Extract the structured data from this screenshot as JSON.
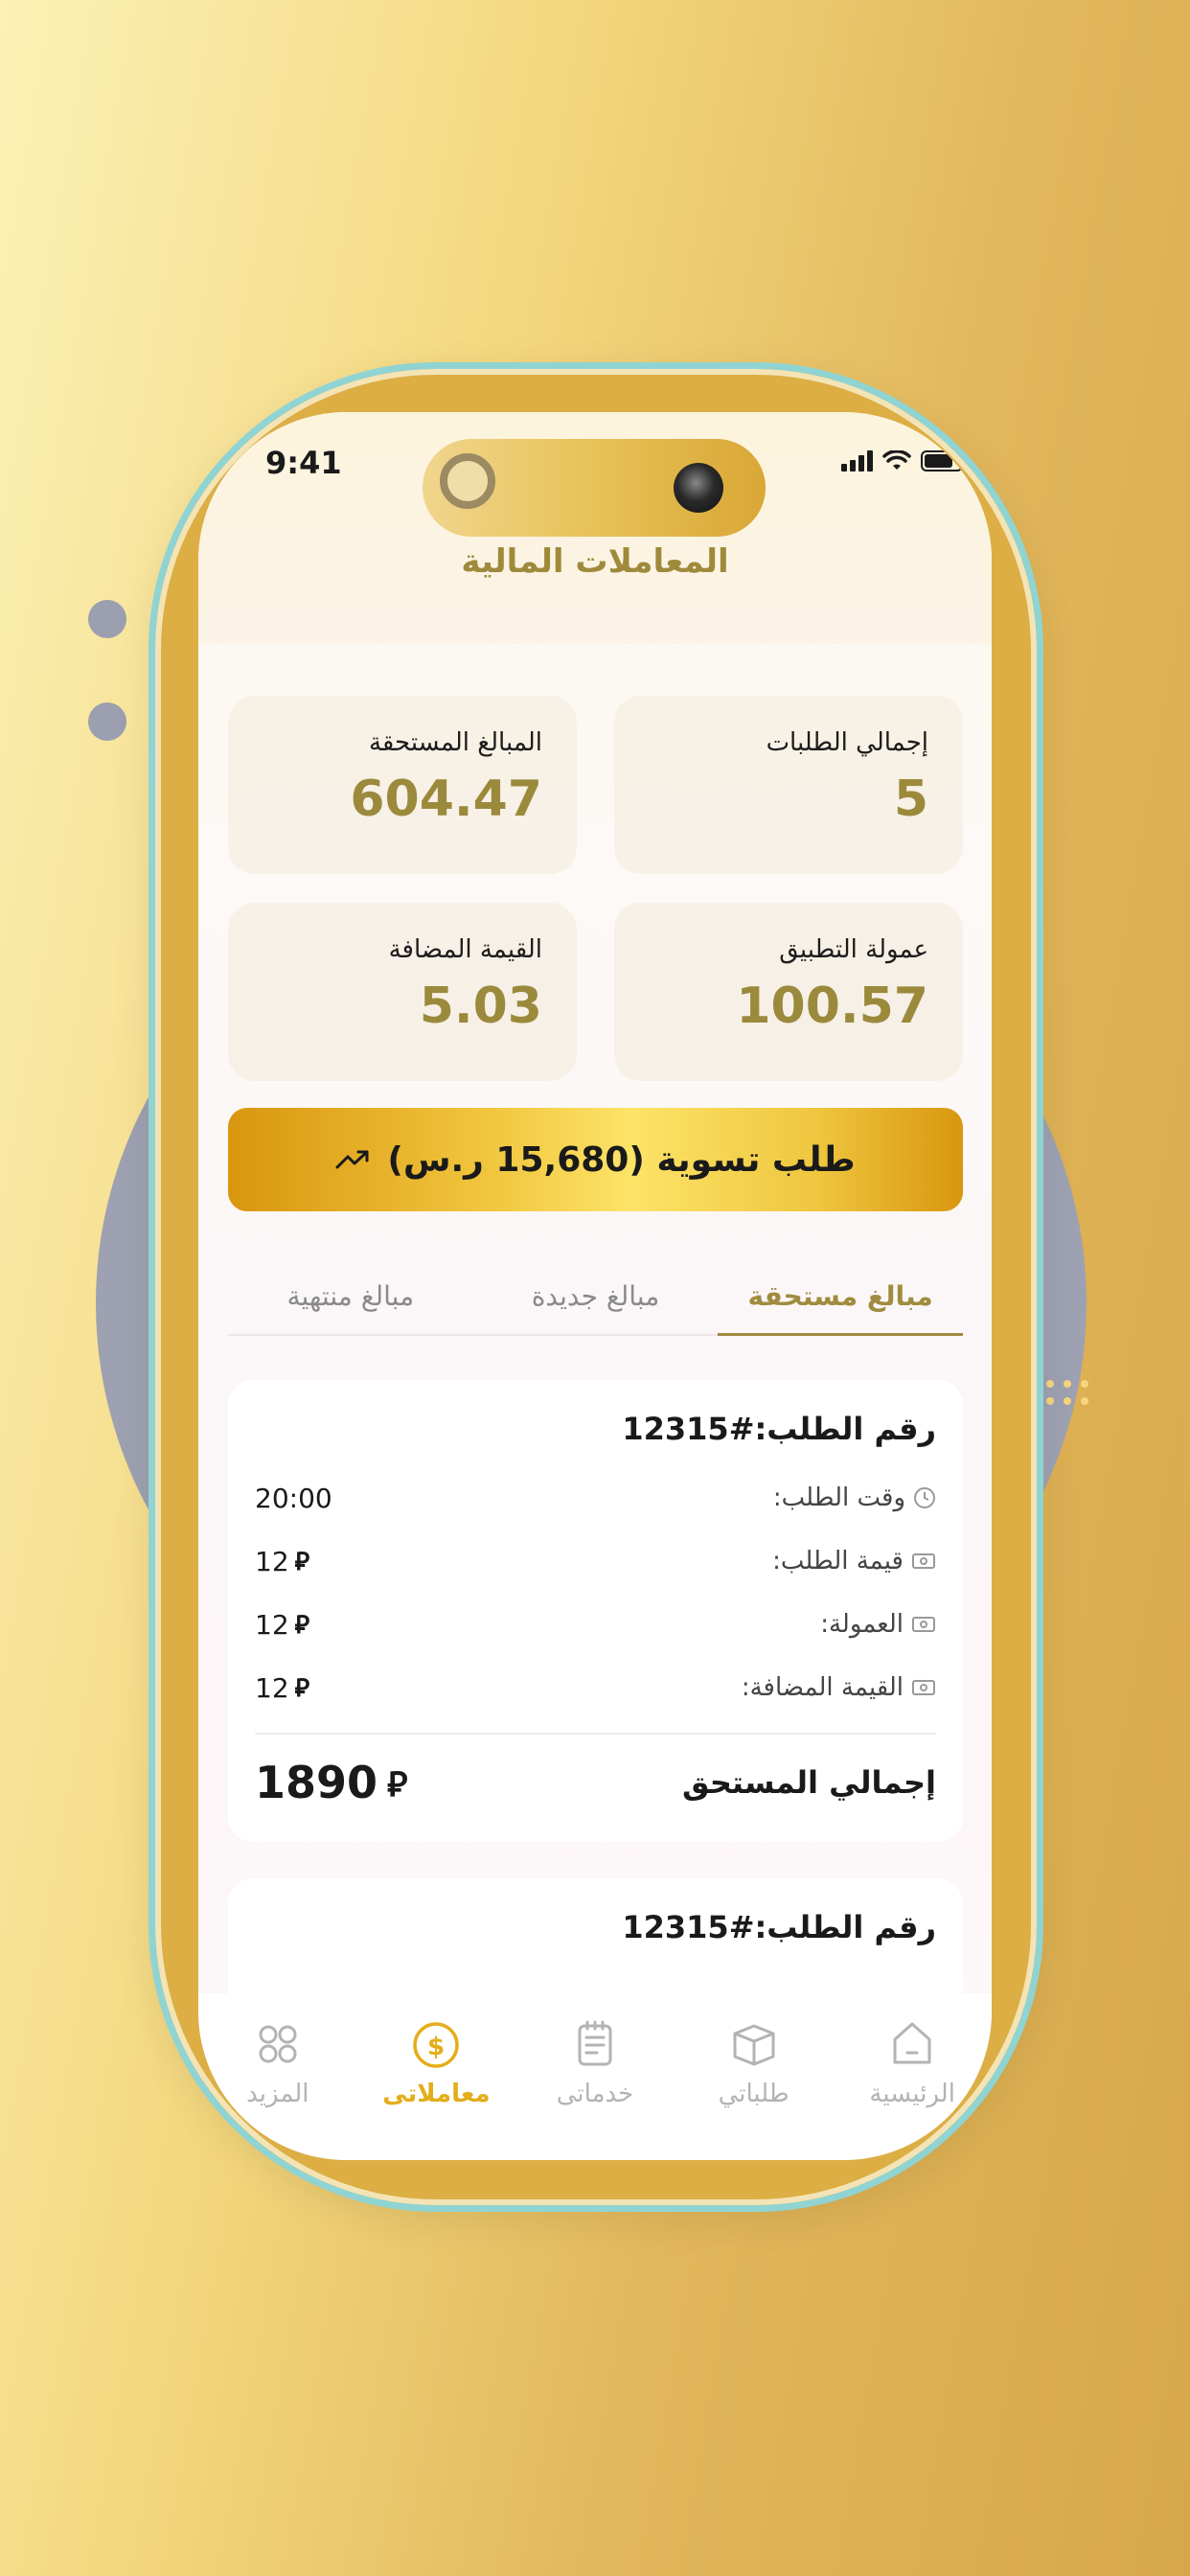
{
  "status_bar": {
    "time": "9:41"
  },
  "page": {
    "title": "المعاملات المالية"
  },
  "stats": [
    {
      "label": "إجمالي الطلبات",
      "value": "5"
    },
    {
      "label": "المبالغ المستحقة",
      "value": "604.47"
    },
    {
      "label": "عمولة التطبيق",
      "value": "100.57"
    },
    {
      "label": "القيمة المضافة",
      "value": "5.03"
    }
  ],
  "settlement_button": {
    "label": "طلب تسوية (15,680 ر.س)",
    "icon": "trending-up-icon"
  },
  "tabs": [
    {
      "label": "مبالغ مستحقة",
      "active": true
    },
    {
      "label": "مبالغ جديدة",
      "active": false
    },
    {
      "label": "مبالغ منتهية",
      "active": false
    }
  ],
  "orders": [
    {
      "number": "رقم الطلب:#12315",
      "rows": [
        {
          "label": "وقت الطلب:",
          "value": "20:00",
          "icon": "clock-icon",
          "currency": false
        },
        {
          "label": "قيمة الطلب:",
          "value": "12",
          "icon": "cash-icon",
          "currency": true
        },
        {
          "label": "العمولة:",
          "value": "12",
          "icon": "cash-icon",
          "currency": true
        },
        {
          "label": "القيمة المضافة:",
          "value": "12",
          "icon": "cash-icon",
          "currency": true
        }
      ],
      "total_label": "إجمالي المستحق",
      "total_value": "1890"
    },
    {
      "number": "رقم الطلب:#12315"
    }
  ],
  "currency_symbol": "⃁",
  "bottom_nav": [
    {
      "label": "الرئيسية",
      "icon": "home-icon",
      "active": false
    },
    {
      "label": "طلباتي",
      "icon": "box-icon",
      "active": false
    },
    {
      "label": "خدماتى",
      "icon": "clipboard-icon",
      "active": false
    },
    {
      "label": "معاملاتى",
      "icon": "dollar-circle-icon",
      "active": true
    },
    {
      "label": "المزيد",
      "icon": "grid-icon",
      "active": false
    }
  ],
  "colors": {
    "accent": "#a08c3f",
    "nav_active": "#e3ae1a",
    "button_gold": "#f0c53d"
  }
}
